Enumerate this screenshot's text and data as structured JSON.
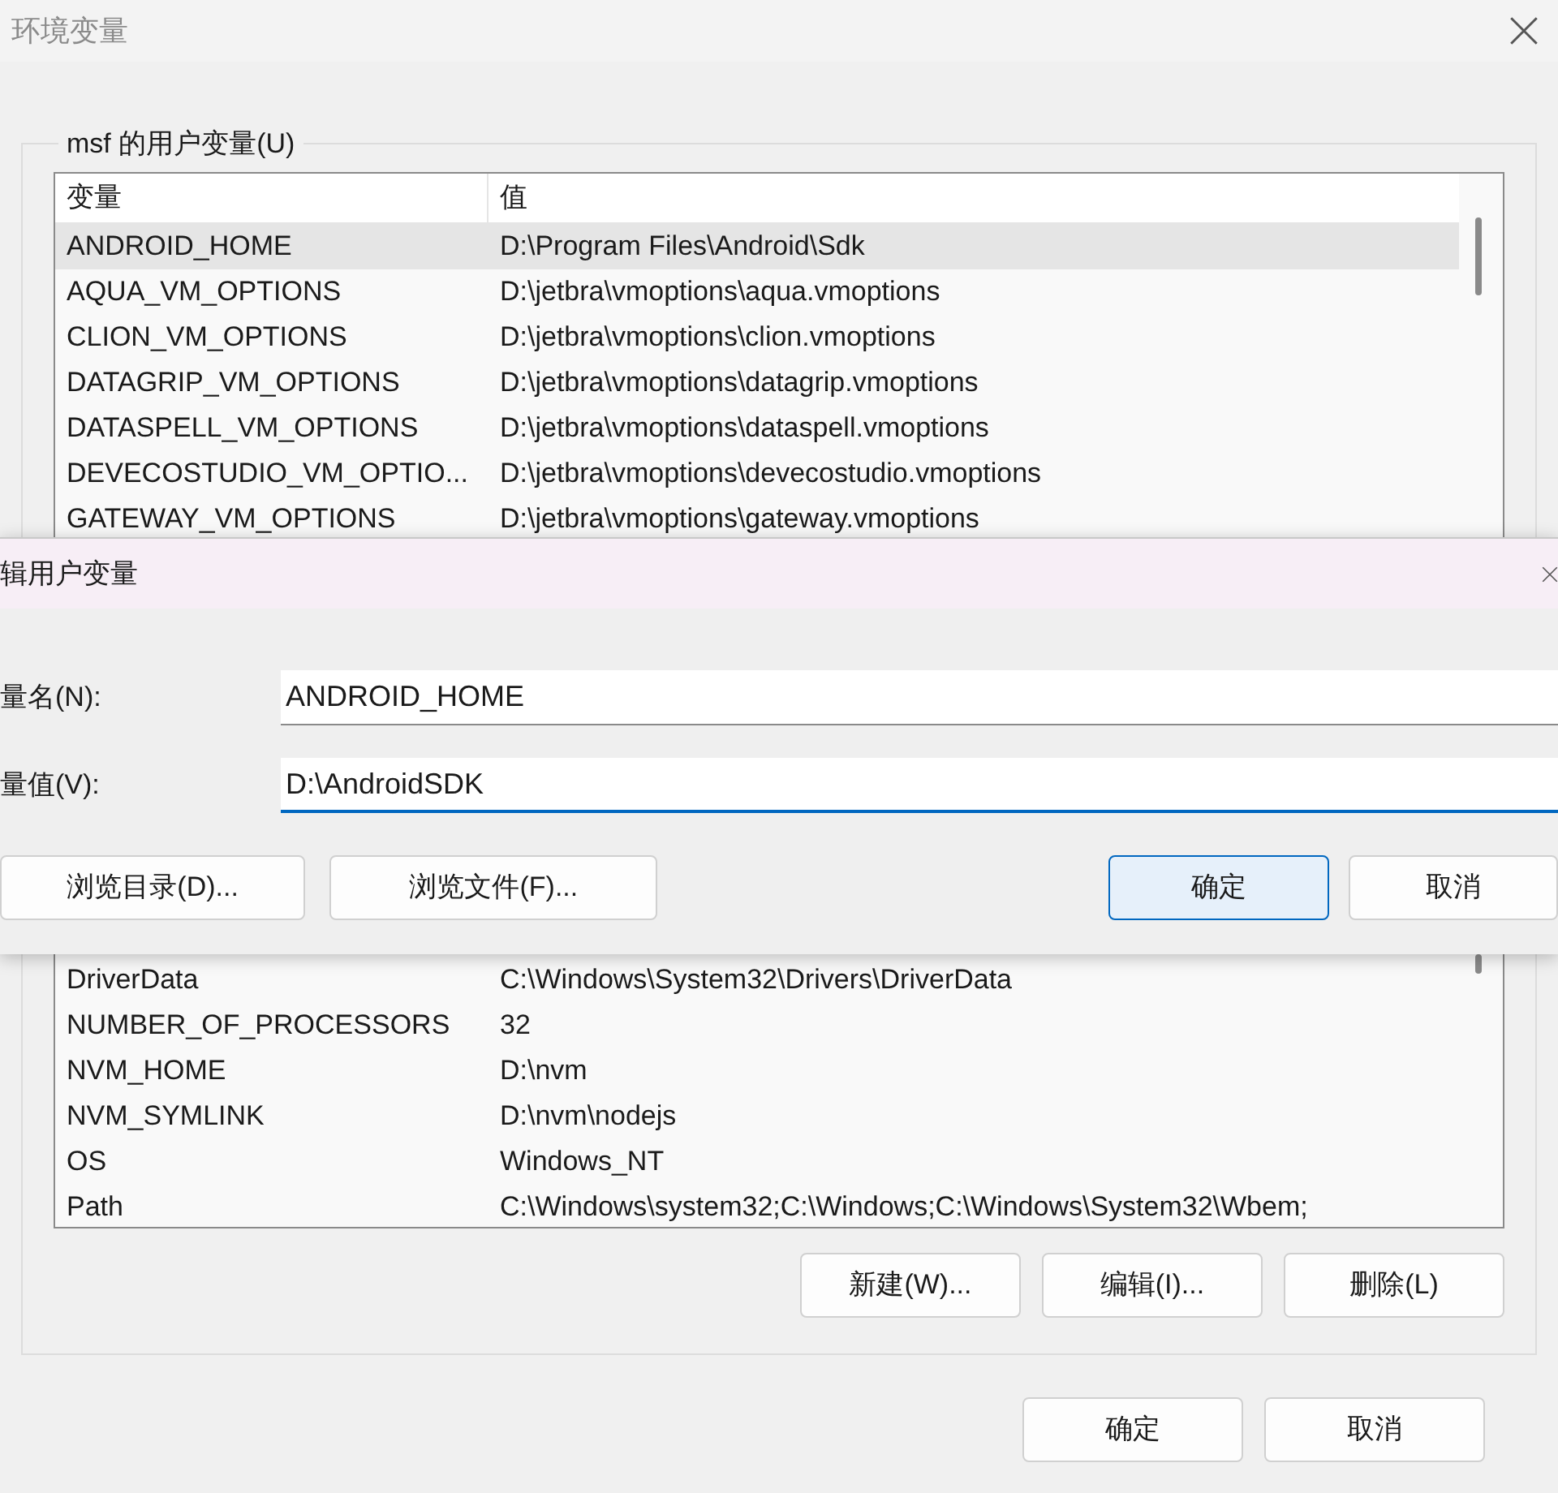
{
  "window": {
    "title": "环境变量"
  },
  "user_variables": {
    "label": "msf 的用户变量(U)",
    "columns": [
      "变量",
      "值"
    ],
    "rows": [
      {
        "name": "ANDROID_HOME",
        "value": "D:\\Program Files\\Android\\Sdk",
        "selected": true
      },
      {
        "name": "AQUA_VM_OPTIONS",
        "value": "D:\\jetbra\\vmoptions\\aqua.vmoptions",
        "selected": false
      },
      {
        "name": "CLION_VM_OPTIONS",
        "value": "D:\\jetbra\\vmoptions\\clion.vmoptions",
        "selected": false
      },
      {
        "name": "DATAGRIP_VM_OPTIONS",
        "value": "D:\\jetbra\\vmoptions\\datagrip.vmoptions",
        "selected": false
      },
      {
        "name": "DATASPELL_VM_OPTIONS",
        "value": "D:\\jetbra\\vmoptions\\dataspell.vmoptions",
        "selected": false
      },
      {
        "name": "DEVECOSTUDIO_VM_OPTIO...",
        "value": "D:\\jetbra\\vmoptions\\devecostudio.vmoptions",
        "selected": false
      },
      {
        "name": "GATEWAY_VM_OPTIONS",
        "value": "D:\\jetbra\\vmoptions\\gateway.vmoptions",
        "selected": false
      }
    ]
  },
  "system_variables": {
    "rows": [
      {
        "name": "DriverData",
        "value": "C:\\Windows\\System32\\Drivers\\DriverData",
        "selected": false
      },
      {
        "name": "NUMBER_OF_PROCESSORS",
        "value": "32",
        "selected": false
      },
      {
        "name": "NVM_HOME",
        "value": "D:\\nvm",
        "selected": false
      },
      {
        "name": "NVM_SYMLINK",
        "value": "D:\\nvm\\nodejs",
        "selected": false
      },
      {
        "name": "OS",
        "value": "Windows_NT",
        "selected": false
      },
      {
        "name": "Path",
        "value": "C:\\Windows\\system32;C:\\Windows;C:\\Windows\\System32\\Wbem;",
        "selected": false
      }
    ]
  },
  "list_buttons": [
    "新建(W)...",
    "编辑(I)...",
    "删除(L)"
  ],
  "footer_buttons": [
    "确定",
    "取消"
  ],
  "edit_dialog": {
    "title": "辑用户变量",
    "fields": [
      {
        "label": "量名(N):",
        "value": "ANDROID_HOME",
        "focused": false
      },
      {
        "label": "量值(V):",
        "value": "D:\\AndroidSDK",
        "focused": true
      }
    ],
    "buttons": [
      {
        "label": "浏览目录(D)...",
        "default": false
      },
      {
        "label": "浏览文件(F)...",
        "default": false
      },
      {
        "label": "确定",
        "default": true
      },
      {
        "label": "取消",
        "default": false
      }
    ]
  }
}
